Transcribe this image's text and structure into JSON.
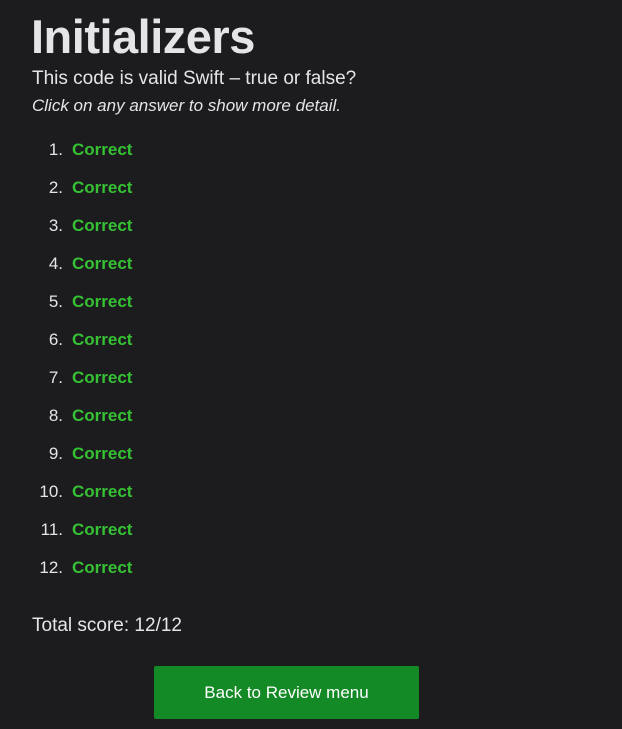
{
  "header": {
    "title": "Initializers",
    "question": "This code is valid Swift – true or false?",
    "hint": "Click on any answer to show more detail."
  },
  "results": [
    {
      "number": "1.",
      "answer": "Correct"
    },
    {
      "number": "2.",
      "answer": "Correct"
    },
    {
      "number": "3.",
      "answer": "Correct"
    },
    {
      "number": "4.",
      "answer": "Correct"
    },
    {
      "number": "5.",
      "answer": "Correct"
    },
    {
      "number": "6.",
      "answer": "Correct"
    },
    {
      "number": "7.",
      "answer": "Correct"
    },
    {
      "number": "8.",
      "answer": "Correct"
    },
    {
      "number": "9.",
      "answer": "Correct"
    },
    {
      "number": "10.",
      "answer": "Correct"
    },
    {
      "number": "11.",
      "answer": "Correct"
    },
    {
      "number": "12.",
      "answer": "Correct"
    }
  ],
  "score": {
    "text": "Total score: 12/12"
  },
  "actions": {
    "back_label": "Back to Review menu"
  },
  "colors": {
    "background": "#1c1c1e",
    "correct": "#35c133",
    "button": "#138a25"
  }
}
